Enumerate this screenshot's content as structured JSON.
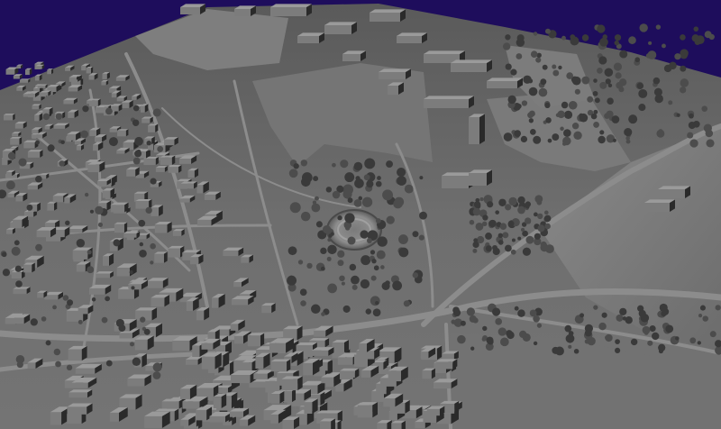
{
  "scene": {
    "kind": "shaded-relief-3d-terrain",
    "sky_color": "#1e0d5c",
    "terrain_base_color": "#6e6e6e",
    "terrain_light_color": "#9a9a9a",
    "terrain_shadow_color": "#2a2a2a",
    "features": [
      "dense-residential-district",
      "road-network",
      "open-fields",
      "large-buildings-cluster",
      "circular-earthwork",
      "tree-rows"
    ]
  }
}
